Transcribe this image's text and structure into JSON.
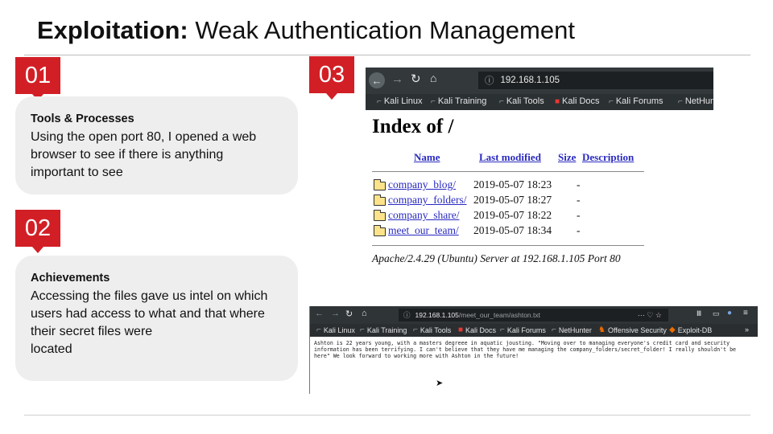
{
  "title": {
    "bold": "Exploitation:",
    "rest": " Weak Authentication Management"
  },
  "steps": [
    {
      "number": "01",
      "heading": "Tools & Processes",
      "body": "Using the open port 80, I opened a web\nbrowser to see if there is anything\nimportant to see"
    },
    {
      "number": "02",
      "heading": "Achievements",
      "body": "Accessing the files gave us intel on which\nusers had access to what and that where\ntheir secret files were\nlocated"
    },
    {
      "number": "03"
    }
  ],
  "screenshot1": {
    "url": "192.168.1.105",
    "bookmarks": [
      "Kali Linux",
      "Kali Training",
      "Kali Tools",
      "Kali Docs",
      "Kali Forums",
      "NetHun"
    ],
    "page_title": "Index of /",
    "columns": [
      "Name",
      "Last modified",
      "Size",
      "Description"
    ],
    "rows": [
      {
        "name": "company_blog/",
        "modified": "2019-05-07 18:23",
        "size": "-"
      },
      {
        "name": "company_folders/",
        "modified": "2019-05-07 18:27",
        "size": "-"
      },
      {
        "name": "company_share/",
        "modified": "2019-05-07 18:22",
        "size": "-"
      },
      {
        "name": "meet_our_team/",
        "modified": "2019-05-07 18:34",
        "size": "-"
      }
    ],
    "footer": "Apache/2.4.29 (Ubuntu) Server at 192.168.1.105 Port 80"
  },
  "screenshot2": {
    "url_host": "192.168.1.105",
    "url_path": "/meet_our_team/ashton.txt",
    "bookmarks": [
      "Kali Linux",
      "Kali Training",
      "Kali Tools",
      "Kali Docs",
      "Kali Forums",
      "NetHunter",
      "Offensive Security",
      "Exploit-DB"
    ],
    "text": "Ashton is 22 years young, with a masters degreee in aquatic jousting. \"Moving over to managing everyone's credit card and security information has been terrifying. I can't believe that they have me managing the company_folders/secret_folder! I really shouldn't be here\" We look forward to working more with Ashton in the future!"
  },
  "colors": {
    "accent": "#d21f26",
    "card": "#eeeeee",
    "link": "#2a2ac0"
  }
}
